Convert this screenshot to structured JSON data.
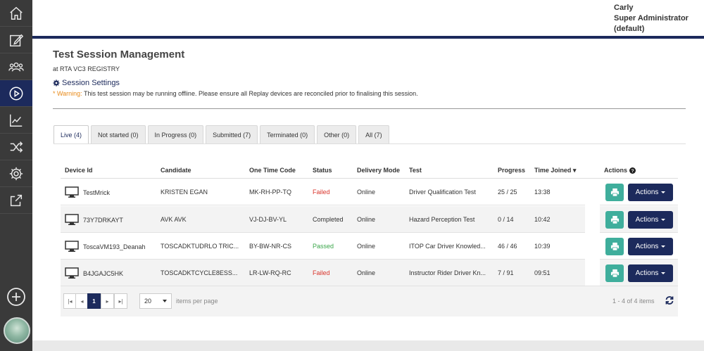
{
  "colors": {
    "accent": "#1c2a5c",
    "teal": "#3fae9c",
    "failed": "#d9342b",
    "passed": "#3aa64a",
    "warning": "#e88a1a"
  },
  "sidebar": {
    "items": [
      {
        "icon": "home-icon"
      },
      {
        "icon": "edit-icon"
      },
      {
        "icon": "people-icon"
      },
      {
        "icon": "play-circle-icon",
        "active": true
      },
      {
        "icon": "chart-line-icon"
      },
      {
        "icon": "shuffle-icon"
      },
      {
        "icon": "gear-icon"
      },
      {
        "icon": "external-link-icon"
      }
    ],
    "add_icon": "plus-circle-icon",
    "avatar": "avatar"
  },
  "header": {
    "user_name": "Carly",
    "user_role": "Super Administrator",
    "user_context": "(default)"
  },
  "page": {
    "title": "Test Session Management",
    "subtitle": "at RTA VC3 REGISTRY",
    "session_settings": "Session Settings",
    "warning_label": "* Warning:",
    "warning_text": " This test session may be running offline. Please ensure all Replay devices are reconciled prior to finalising this session."
  },
  "tabs": [
    {
      "label": "Live (4)",
      "active": true
    },
    {
      "label": "Not started (0)"
    },
    {
      "label": "In Progress (0)"
    },
    {
      "label": "Submitted (7)"
    },
    {
      "label": "Terminated (0)"
    },
    {
      "label": "Other (0)"
    },
    {
      "label": "All (7)"
    }
  ],
  "table": {
    "headers": {
      "device_id": "Device Id",
      "candidate": "Candidate",
      "code": "One Time Code",
      "status": "Status",
      "delivery": "Delivery Mode",
      "test": "Test",
      "progress": "Progress",
      "time_joined": "Time Joined ▾",
      "actions": "Actions"
    },
    "rows": [
      {
        "device": "TestMrick",
        "candidate": "KRISTEN EGAN",
        "code": "MK-RH-PP-TQ",
        "status": "Failed",
        "delivery": "Online",
        "test": "Driver Qualification Test",
        "progress": "25 / 25",
        "time": "13:38",
        "actions": "Actions"
      },
      {
        "device": "73Y7DRKAYT",
        "candidate": "AVK AVK",
        "code": "VJ-DJ-BV-YL",
        "status": "Completed",
        "delivery": "Online",
        "test": "Hazard Perception Test",
        "progress": "0 / 14",
        "time": "10:42",
        "actions": "Actions"
      },
      {
        "device": "ToscaVM193_Deanah",
        "candidate": "TOSCADKTUDRLO TRIC...",
        "code": "BY-BW-NR-CS",
        "status": "Passed",
        "delivery": "Online",
        "test": "ITOP Car Driver Knowled...",
        "progress": "46 / 46",
        "time": "10:39",
        "actions": "Actions"
      },
      {
        "device": "B4JGAJC5HK",
        "candidate": "TOSCADKTCYCLE8ESS...",
        "code": "LR-LW-RQ-RC",
        "status": "Failed",
        "delivery": "Online",
        "test": "Instructor Rider Driver Kn...",
        "progress": "7 / 91",
        "time": "09:51",
        "actions": "Actions"
      }
    ]
  },
  "pager": {
    "first": "|◂",
    "prev": "◂",
    "current": "1",
    "next": "▸",
    "last": "▸|",
    "per_page": "20",
    "per_page_label": "items per page",
    "item_count": "1 - 4 of 4 items"
  }
}
